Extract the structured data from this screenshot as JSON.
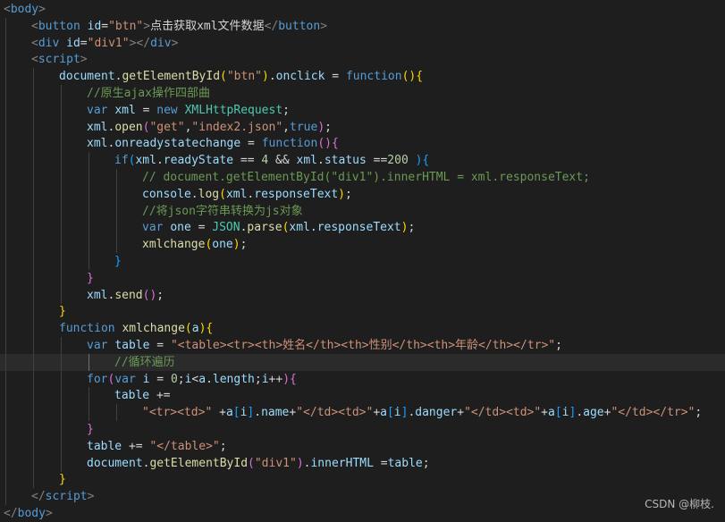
{
  "colors": {
    "background": "#1e1e1e",
    "tag": "#569cd6",
    "attr": "#9cdcfe",
    "string": "#ce9178",
    "keyword": "#569cd6",
    "function": "#dcdcaa",
    "method": "#dcdcaa",
    "comment": "#6a9955",
    "number": "#b5cea8",
    "bracket_gold": "#ffd700",
    "bracket_pink": "#da70d6",
    "bracket_blue": "#179fff",
    "object": "#4ec9b0",
    "variable": "#9cdcfe",
    "text": "#d4d4d4",
    "punct": "#808080"
  },
  "editor": {
    "highlighted_line": 21,
    "lines": [
      {
        "indent": 0,
        "tokens": [
          [
            "<",
            "punct"
          ],
          [
            "body",
            "tag"
          ],
          [
            ">",
            "punct"
          ]
        ]
      },
      {
        "indent": 1,
        "tokens": [
          [
            "<",
            "punct"
          ],
          [
            "button",
            "tag"
          ],
          [
            " ",
            "text"
          ],
          [
            "id",
            "attr"
          ],
          [
            "=",
            "text"
          ],
          [
            "\"btn\"",
            "string"
          ],
          [
            ">",
            "punct"
          ],
          [
            "点击获取xml文件数据",
            "text"
          ],
          [
            "</",
            "punct"
          ],
          [
            "button",
            "tag"
          ],
          [
            ">",
            "punct"
          ]
        ]
      },
      {
        "indent": 1,
        "tokens": [
          [
            "<",
            "punct"
          ],
          [
            "div",
            "tag"
          ],
          [
            " ",
            "text"
          ],
          [
            "id",
            "attr"
          ],
          [
            "=",
            "text"
          ],
          [
            "\"div1\"",
            "string"
          ],
          [
            "></",
            "punct"
          ],
          [
            "div",
            "tag"
          ],
          [
            ">",
            "punct"
          ]
        ]
      },
      {
        "indent": 1,
        "tokens": [
          [
            "<",
            "punct"
          ],
          [
            "script",
            "tag"
          ],
          [
            ">",
            "punct"
          ]
        ]
      },
      {
        "indent": 2,
        "tokens": [
          [
            "document",
            "variable"
          ],
          [
            ".",
            "text"
          ],
          [
            "getElementById",
            "method"
          ],
          [
            "(",
            "bracket_gold"
          ],
          [
            "\"btn\"",
            "string"
          ],
          [
            ")",
            "bracket_gold"
          ],
          [
            ".",
            "text"
          ],
          [
            "onclick",
            "variable"
          ],
          [
            " = ",
            "text"
          ],
          [
            "function",
            "keyword"
          ],
          [
            "(){",
            "bracket_gold"
          ]
        ]
      },
      {
        "indent": 3,
        "tokens": [
          [
            "//原生ajax操作四部曲",
            "comment"
          ]
        ]
      },
      {
        "indent": 3,
        "tokens": [
          [
            "var",
            "keyword"
          ],
          [
            " ",
            "text"
          ],
          [
            "xml",
            "variable"
          ],
          [
            " = ",
            "text"
          ],
          [
            "new",
            "keyword"
          ],
          [
            " ",
            "text"
          ],
          [
            "XMLHttpRequest",
            "object"
          ],
          [
            ";",
            "text"
          ]
        ]
      },
      {
        "indent": 3,
        "tokens": [
          [
            "xml",
            "variable"
          ],
          [
            ".",
            "text"
          ],
          [
            "open",
            "method"
          ],
          [
            "(",
            "bracket_pink"
          ],
          [
            "\"get\"",
            "string"
          ],
          [
            ",",
            "text"
          ],
          [
            "\"index2.json\"",
            "string"
          ],
          [
            ",",
            "text"
          ],
          [
            "true",
            "keyword"
          ],
          [
            ")",
            "bracket_pink"
          ],
          [
            ";",
            "text"
          ]
        ]
      },
      {
        "indent": 3,
        "tokens": [
          [
            "xml",
            "variable"
          ],
          [
            ".",
            "text"
          ],
          [
            "onreadystatechange",
            "variable"
          ],
          [
            " = ",
            "text"
          ],
          [
            "function",
            "keyword"
          ],
          [
            "(){",
            "bracket_pink"
          ]
        ]
      },
      {
        "indent": 4,
        "tokens": [
          [
            "if",
            "keyword"
          ],
          [
            "(",
            "bracket_blue"
          ],
          [
            "xml",
            "variable"
          ],
          [
            ".",
            "text"
          ],
          [
            "readyState",
            "variable"
          ],
          [
            " == ",
            "text"
          ],
          [
            "4",
            "number"
          ],
          [
            " && ",
            "text"
          ],
          [
            "xml",
            "variable"
          ],
          [
            ".",
            "text"
          ],
          [
            "status",
            "variable"
          ],
          [
            " ==",
            "text"
          ],
          [
            "200",
            "number"
          ],
          [
            " ){",
            "bracket_blue"
          ]
        ]
      },
      {
        "indent": 5,
        "tokens": [
          [
            "// document.getElementById(\"div1\").innerHTML = xml.responseText;",
            "comment"
          ]
        ]
      },
      {
        "indent": 5,
        "tokens": [
          [
            "console",
            "variable"
          ],
          [
            ".",
            "text"
          ],
          [
            "log",
            "method"
          ],
          [
            "(",
            "bracket_gold"
          ],
          [
            "xml",
            "variable"
          ],
          [
            ".",
            "text"
          ],
          [
            "responseText",
            "variable"
          ],
          [
            ")",
            "bracket_gold"
          ],
          [
            ";",
            "text"
          ]
        ]
      },
      {
        "indent": 5,
        "tokens": [
          [
            "//将json字符串转换为js对象",
            "comment"
          ]
        ]
      },
      {
        "indent": 5,
        "tokens": [
          [
            "var",
            "keyword"
          ],
          [
            " ",
            "text"
          ],
          [
            "one",
            "variable"
          ],
          [
            " = ",
            "text"
          ],
          [
            "JSON",
            "object"
          ],
          [
            ".",
            "text"
          ],
          [
            "parse",
            "method"
          ],
          [
            "(",
            "bracket_gold"
          ],
          [
            "xml",
            "variable"
          ],
          [
            ".",
            "text"
          ],
          [
            "responseText",
            "variable"
          ],
          [
            ")",
            "bracket_gold"
          ],
          [
            ";",
            "text"
          ]
        ]
      },
      {
        "indent": 5,
        "tokens": [
          [
            "xmlchange",
            "function"
          ],
          [
            "(",
            "bracket_gold"
          ],
          [
            "one",
            "variable"
          ],
          [
            ")",
            "bracket_gold"
          ],
          [
            ";",
            "text"
          ]
        ]
      },
      {
        "indent": 4,
        "tokens": [
          [
            "}",
            "bracket_blue"
          ]
        ]
      },
      {
        "indent": 3,
        "tokens": [
          [
            "}",
            "bracket_pink"
          ]
        ]
      },
      {
        "indent": 3,
        "tokens": [
          [
            "xml",
            "variable"
          ],
          [
            ".",
            "text"
          ],
          [
            "send",
            "method"
          ],
          [
            "()",
            "bracket_pink"
          ],
          [
            ";",
            "text"
          ]
        ]
      },
      {
        "indent": 2,
        "tokens": [
          [
            "}",
            "bracket_gold"
          ]
        ]
      },
      {
        "indent": 2,
        "tokens": [
          [
            "function",
            "keyword"
          ],
          [
            " ",
            "text"
          ],
          [
            "xmlchange",
            "function"
          ],
          [
            "(",
            "bracket_gold"
          ],
          [
            "a",
            "variable"
          ],
          [
            "){",
            "bracket_gold"
          ]
        ]
      },
      {
        "indent": 3,
        "tokens": [
          [
            "var",
            "keyword"
          ],
          [
            " ",
            "text"
          ],
          [
            "table",
            "variable"
          ],
          [
            " = ",
            "text"
          ],
          [
            "\"<table><tr><th>姓名</th><th>性别</th><th>年龄</th></tr>\"",
            "string"
          ],
          [
            ";",
            "text"
          ]
        ]
      },
      {
        "indent": 4,
        "tokens": [
          [
            "//循环遍历",
            "comment"
          ]
        ]
      },
      {
        "indent": 3,
        "tokens": [
          [
            "for",
            "keyword"
          ],
          [
            "(",
            "bracket_pink"
          ],
          [
            "var",
            "keyword"
          ],
          [
            " ",
            "text"
          ],
          [
            "i",
            "variable"
          ],
          [
            " = ",
            "text"
          ],
          [
            "0",
            "number"
          ],
          [
            ";",
            "text"
          ],
          [
            "i",
            "variable"
          ],
          [
            "<",
            "text"
          ],
          [
            "a",
            "variable"
          ],
          [
            ".",
            "text"
          ],
          [
            "length",
            "variable"
          ],
          [
            ";",
            "text"
          ],
          [
            "i",
            "variable"
          ],
          [
            "++",
            "text"
          ],
          [
            "){",
            "bracket_pink"
          ]
        ]
      },
      {
        "indent": 4,
        "tokens": [
          [
            "table",
            "variable"
          ],
          [
            " +=",
            "text"
          ]
        ]
      },
      {
        "indent": 5,
        "tokens": [
          [
            "\"<tr><td>\"",
            "string"
          ],
          [
            " +",
            "text"
          ],
          [
            "a",
            "variable"
          ],
          [
            "[",
            "bracket_blue"
          ],
          [
            "i",
            "variable"
          ],
          [
            "]",
            "bracket_blue"
          ],
          [
            ".",
            "text"
          ],
          [
            "name",
            "variable"
          ],
          [
            "+",
            "text"
          ],
          [
            "\"</td><td>\"",
            "string"
          ],
          [
            "+",
            "text"
          ],
          [
            "a",
            "variable"
          ],
          [
            "[",
            "bracket_blue"
          ],
          [
            "i",
            "variable"
          ],
          [
            "]",
            "bracket_blue"
          ],
          [
            ".",
            "text"
          ],
          [
            "danger",
            "variable"
          ],
          [
            "+",
            "text"
          ],
          [
            "\"</td><td>\"",
            "string"
          ],
          [
            "+",
            "text"
          ],
          [
            "a",
            "variable"
          ],
          [
            "[",
            "bracket_blue"
          ],
          [
            "i",
            "variable"
          ],
          [
            "]",
            "bracket_blue"
          ],
          [
            ".",
            "text"
          ],
          [
            "age",
            "variable"
          ],
          [
            "+",
            "text"
          ],
          [
            "\"</td></tr>\"",
            "string"
          ],
          [
            ";",
            "text"
          ]
        ]
      },
      {
        "indent": 3,
        "tokens": [
          [
            "}",
            "bracket_pink"
          ]
        ]
      },
      {
        "indent": 3,
        "tokens": [
          [
            "table",
            "variable"
          ],
          [
            " += ",
            "text"
          ],
          [
            "\"</table>\"",
            "string"
          ],
          [
            ";",
            "text"
          ]
        ]
      },
      {
        "indent": 3,
        "tokens": [
          [
            "document",
            "variable"
          ],
          [
            ".",
            "text"
          ],
          [
            "getElementById",
            "method"
          ],
          [
            "(",
            "bracket_pink"
          ],
          [
            "\"div1\"",
            "string"
          ],
          [
            ")",
            "bracket_pink"
          ],
          [
            ".",
            "text"
          ],
          [
            "innerHTML",
            "variable"
          ],
          [
            " =",
            "text"
          ],
          [
            "table",
            "variable"
          ],
          [
            ";",
            "text"
          ]
        ]
      },
      {
        "indent": 2,
        "tokens": [
          [
            "}",
            "bracket_gold"
          ]
        ]
      },
      {
        "indent": 1,
        "tokens": [
          [
            "</",
            "punct"
          ],
          [
            "script",
            "tag"
          ],
          [
            ">",
            "punct"
          ]
        ]
      },
      {
        "indent": 0,
        "tokens": [
          [
            "</",
            "punct"
          ],
          [
            "body",
            "tag"
          ],
          [
            ">",
            "punct"
          ]
        ]
      }
    ]
  },
  "watermark": "CSDN @柳枝."
}
